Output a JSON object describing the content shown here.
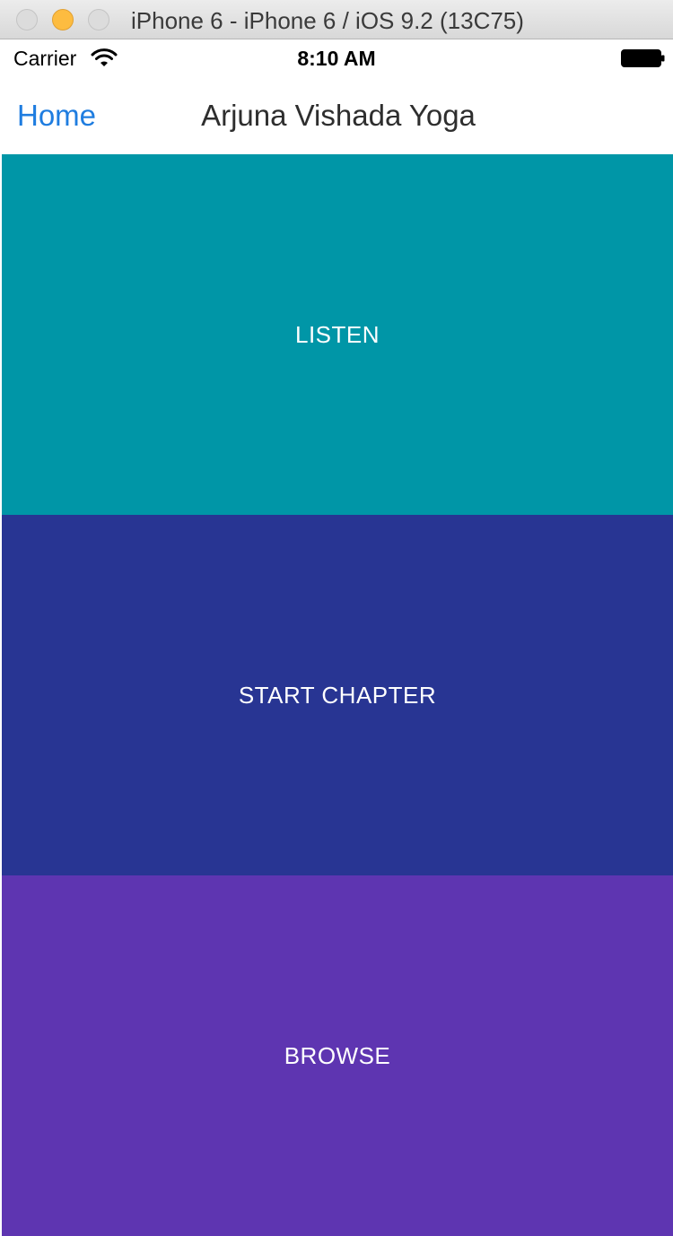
{
  "window": {
    "title": "iPhone 6 - iPhone 6 / iOS 9.2 (13C75)"
  },
  "status_bar": {
    "carrier": "Carrier",
    "time": "8:10 AM",
    "wifi_icon": "wifi-icon",
    "battery_icon": "battery-icon"
  },
  "nav_bar": {
    "back_label": "Home",
    "title": "Arjuna Vishada Yoga"
  },
  "actions": [
    {
      "label": "LISTEN",
      "color": "#0096a7"
    },
    {
      "label": "START CHAPTER",
      "color": "#283593"
    },
    {
      "label": "BROWSE",
      "color": "#5e35b1"
    }
  ],
  "colors": {
    "accent": "#1f7de0"
  }
}
